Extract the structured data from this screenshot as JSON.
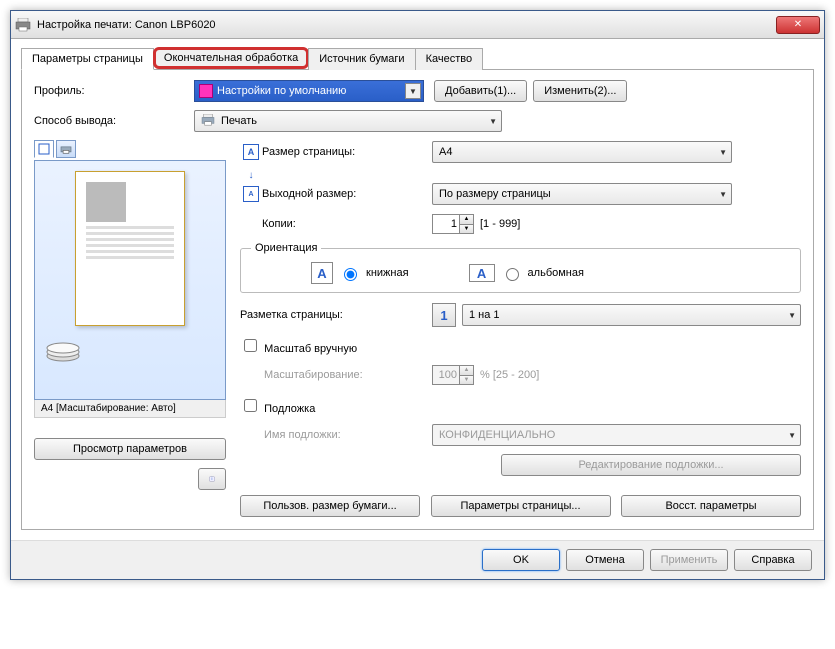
{
  "window": {
    "title": "Настройка печати: Canon LBP6020"
  },
  "tabs": {
    "page": "Параметры страницы",
    "finishing": "Окончательная обработка",
    "paper": "Источник бумаги",
    "quality": "Качество"
  },
  "profile": {
    "label": "Профиль:",
    "value": "Настройки по умолчанию",
    "add_btn": "Добавить(1)...",
    "edit_btn": "Изменить(2)..."
  },
  "output": {
    "label": "Способ вывода:",
    "value": "Печать"
  },
  "page_size": {
    "label": "Размер страницы:",
    "value": "A4"
  },
  "output_size": {
    "label": "Выходной размер:",
    "value": "По размеру страницы"
  },
  "copies": {
    "label": "Копии:",
    "value": "1",
    "range": "[1 - 999]"
  },
  "orientation": {
    "legend": "Ориентация",
    "portrait": "книжная",
    "landscape": "альбомная"
  },
  "layout": {
    "label": "Разметка страницы:",
    "value": "1 на 1"
  },
  "scale_manual": {
    "check": "Масштаб вручную",
    "label": "Масштабирование:",
    "value": "100",
    "range": "% [25 - 200]"
  },
  "watermark": {
    "check": "Подложка",
    "label": "Имя подложки:",
    "value": "КОНФИДЕНЦИАЛЬНО",
    "edit_btn": "Редактирование подложки..."
  },
  "preview": {
    "footer": "A4 [Масштабирование: Авто]",
    "view_btn": "Просмотр параметров"
  },
  "bottom": {
    "custom_size": "Пользов. размер бумаги...",
    "page_params": "Параметры страницы...",
    "restore": "Восст. параметры"
  },
  "dialog": {
    "ok": "OK",
    "cancel": "Отмена",
    "apply": "Применить",
    "help": "Справка"
  }
}
